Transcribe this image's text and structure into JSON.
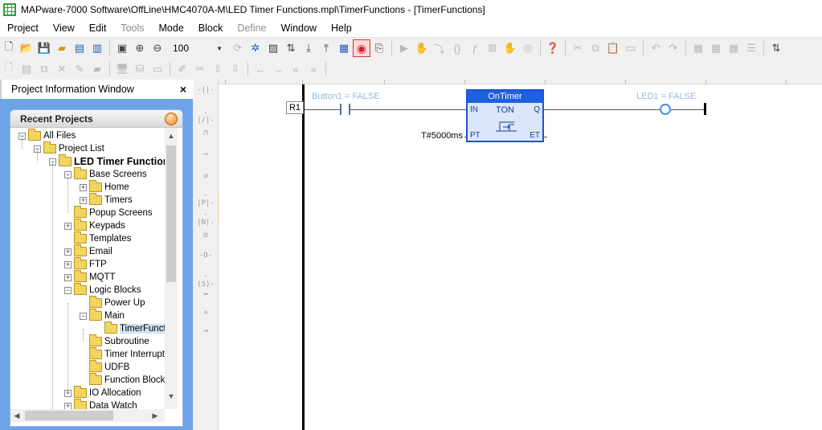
{
  "window": {
    "title": "MAPware-7000 Software\\OffLine\\HMC4070A-M\\LED Timer Functions.mpl\\TimerFunctions - [TimerFunctions]"
  },
  "menu": [
    {
      "label": "Project",
      "enabled": true
    },
    {
      "label": "View",
      "enabled": true
    },
    {
      "label": "Edit",
      "enabled": true
    },
    {
      "label": "Tools",
      "enabled": false
    },
    {
      "label": "Mode",
      "enabled": true
    },
    {
      "label": "Block",
      "enabled": true
    },
    {
      "label": "Define",
      "enabled": false
    },
    {
      "label": "Window",
      "enabled": true
    },
    {
      "label": "Help",
      "enabled": true
    }
  ],
  "toolbar": {
    "zoom_value": "100"
  },
  "project_panel": {
    "title": "Project Information Window",
    "close_glyph": "×",
    "recent_title": "Recent Projects",
    "tree": [
      {
        "label": "All Files",
        "level": 0,
        "expander": "−"
      },
      {
        "label": "Project List",
        "level": 1,
        "expander": "−"
      },
      {
        "label": "LED Timer Functions",
        "level": 2,
        "expander": "−",
        "bold": true
      },
      {
        "label": "Base Screens",
        "level": 3,
        "expander": "−"
      },
      {
        "label": "Home",
        "level": 4,
        "expander": "+"
      },
      {
        "label": "Timers",
        "level": 4,
        "expander": "+"
      },
      {
        "label": "Popup Screens",
        "level": 3,
        "expander": ""
      },
      {
        "label": "Keypads",
        "level": 3,
        "expander": "+"
      },
      {
        "label": "Templates",
        "level": 3,
        "expander": ""
      },
      {
        "label": "Email",
        "level": 3,
        "expander": "+"
      },
      {
        "label": "FTP",
        "level": 3,
        "expander": "+"
      },
      {
        "label": "MQTT",
        "level": 3,
        "expander": "+"
      },
      {
        "label": "Logic Blocks",
        "level": 3,
        "expander": "−"
      },
      {
        "label": "Power Up",
        "level": 4,
        "expander": ""
      },
      {
        "label": "Main",
        "level": 4,
        "expander": "−"
      },
      {
        "label": "TimerFunctions",
        "level": 5,
        "expander": "",
        "selected": true,
        "open": true
      },
      {
        "label": "Subroutine",
        "level": 4,
        "expander": ""
      },
      {
        "label": "Timer Interrupt",
        "level": 4,
        "expander": ""
      },
      {
        "label": "UDFB",
        "level": 4,
        "expander": ""
      },
      {
        "label": "Function Blocks",
        "level": 4,
        "expander": ""
      },
      {
        "label": "IO Allocation",
        "level": 3,
        "expander": "+"
      },
      {
        "label": "Data Watch",
        "level": 3,
        "expander": "+"
      }
    ]
  },
  "ladder": {
    "rung_label": "R1",
    "contact_label": "Button1 = FALSE",
    "timer": {
      "instance": "OnTimer",
      "type": "TON",
      "pin_in": "IN",
      "pin_q": "Q",
      "pin_pt": "PT",
      "pin_et": "ET",
      "preset": "T#5000ms"
    },
    "coil_label": "LED1 = FALSE",
    "colors": {
      "rail": "#000000",
      "block_border": "#1a54d6",
      "block_header": "#1f5fe0",
      "label": "#9ab6dd"
    }
  }
}
